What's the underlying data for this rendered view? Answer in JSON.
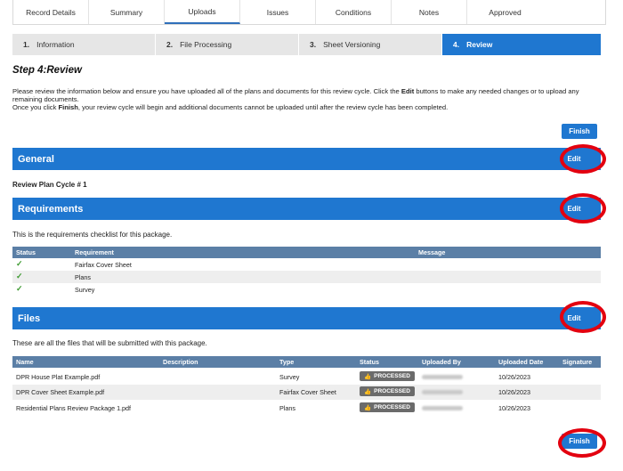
{
  "tabs": [
    "Record Details",
    "Summary",
    "Uploads",
    "Issues",
    "Conditions",
    "Notes",
    "Approved"
  ],
  "active_tab": "Uploads",
  "steps": [
    {
      "num": "1.",
      "label": "Information"
    },
    {
      "num": "2.",
      "label": "File Processing"
    },
    {
      "num": "3.",
      "label": "Sheet Versioning"
    },
    {
      "num": "4.",
      "label": "Review"
    }
  ],
  "page_title": "Step 4:Review",
  "intro": {
    "line1a": "Please review the information below and ensure you have uploaded all of the plans and documents for this review cycle. Click the ",
    "line1b": "Edit",
    "line1c": " buttons to make any needed changes or to upload any remaining documents.",
    "line2a": "Once you click ",
    "line2b": "Finish",
    "line2c": ", your review cycle will begin and additional documents cannot be uploaded until after the review cycle has been completed."
  },
  "finish_label": "Finish",
  "edit_label": "Edit",
  "general": {
    "title": "General",
    "cycle_text": "Review Plan Cycle # 1"
  },
  "requirements": {
    "title": "Requirements",
    "description": "This is the requirements checklist for this package.",
    "columns": {
      "status": "Status",
      "requirement": "Requirement",
      "message": "Message"
    },
    "rows": [
      {
        "status": "✓",
        "requirement": "Fairfax Cover Sheet",
        "message": ""
      },
      {
        "status": "✓",
        "requirement": "Plans",
        "message": ""
      },
      {
        "status": "✓",
        "requirement": "Survey",
        "message": ""
      }
    ]
  },
  "files": {
    "title": "Files",
    "description": "These are all the files that will be submitted with this package.",
    "columns": {
      "name": "Name",
      "description": "Description",
      "type": "Type",
      "status": "Status",
      "uploaded_by": "Uploaded By",
      "uploaded_date": "Uploaded Date",
      "signature": "Signature"
    },
    "rows": [
      {
        "name": "DPR House Plat Example.pdf",
        "description": "",
        "type": "Survey",
        "status": "PROCESSED",
        "uploaded_date": "10/26/2023"
      },
      {
        "name": "DPR Cover Sheet Example.pdf",
        "description": "",
        "type": "Fairfax Cover Sheet",
        "status": "PROCESSED",
        "uploaded_date": "10/26/2023"
      },
      {
        "name": "Residential Plans Review Package 1.pdf",
        "description": "",
        "type": "Plans",
        "status": "PROCESSED",
        "uploaded_date": "10/26/2023"
      }
    ]
  },
  "colors": {
    "accent": "#1f77d0",
    "table_header": "#5b7fa6",
    "highlight_ring": "#e3000f",
    "check": "#3c9a2f",
    "badge": "#6b6b6b"
  },
  "icons": {
    "check": "check-icon",
    "processed": "thumbs-up-icon"
  }
}
